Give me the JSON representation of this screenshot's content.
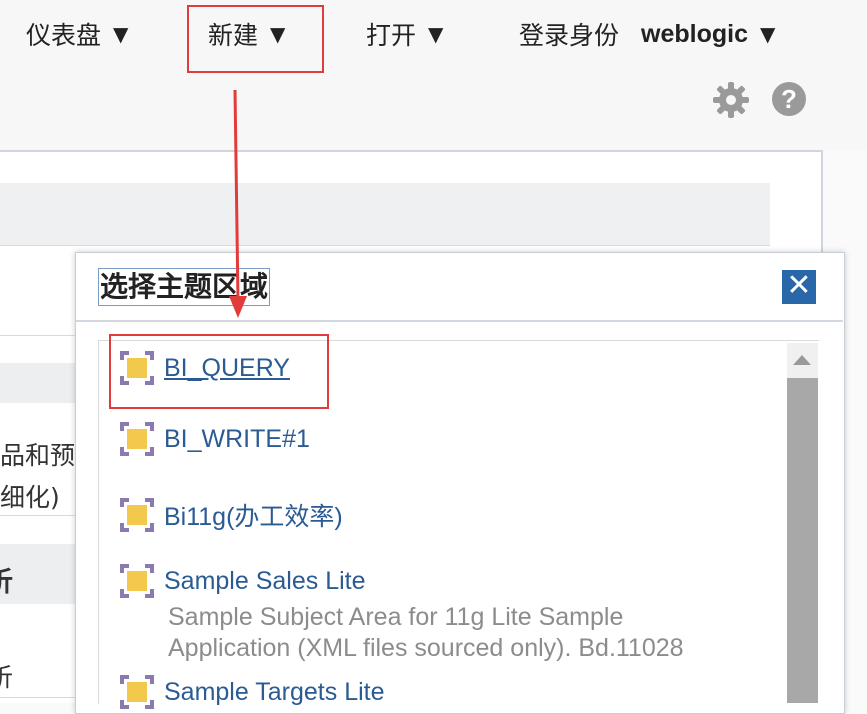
{
  "header": {
    "menus": [
      {
        "label": "仪表盘",
        "caret": "▼"
      },
      {
        "label": "新建",
        "caret": "▼"
      },
      {
        "label": "打开",
        "caret": "▼"
      },
      {
        "label": "登录身份",
        "caret": "▼"
      }
    ],
    "user": "weblogic",
    "help_glyph": "?"
  },
  "background": {
    "fragment_1": "品和预览",
    "fragment_2": "细化)",
    "fragment_3": "析",
    "fragment_4": "析"
  },
  "dialog": {
    "title": "选择主题区域",
    "close_glyph": "✕",
    "items": [
      {
        "label": "BI_QUERY"
      },
      {
        "label": "BI_WRITE#1"
      },
      {
        "label": "Bi11g(办工效率)"
      },
      {
        "label": "Sample Sales Lite",
        "desc_line1": "Sample Subject Area for 11g Lite Sample",
        "desc_line2": "Application (XML files sourced only). Bd.11028"
      },
      {
        "label": "Sample Targets Lite"
      }
    ]
  },
  "icons": {
    "subject_area": "subject-area-icon",
    "gear": "gear-icon",
    "help": "help-icon",
    "close": "close-icon"
  },
  "colors": {
    "annotation_red": "#e23b3b",
    "link_blue": "#2a5b93",
    "close_button": "#2a67a8",
    "icon_gold": "#f2c94c",
    "icon_purple": "#8a7ab0"
  }
}
